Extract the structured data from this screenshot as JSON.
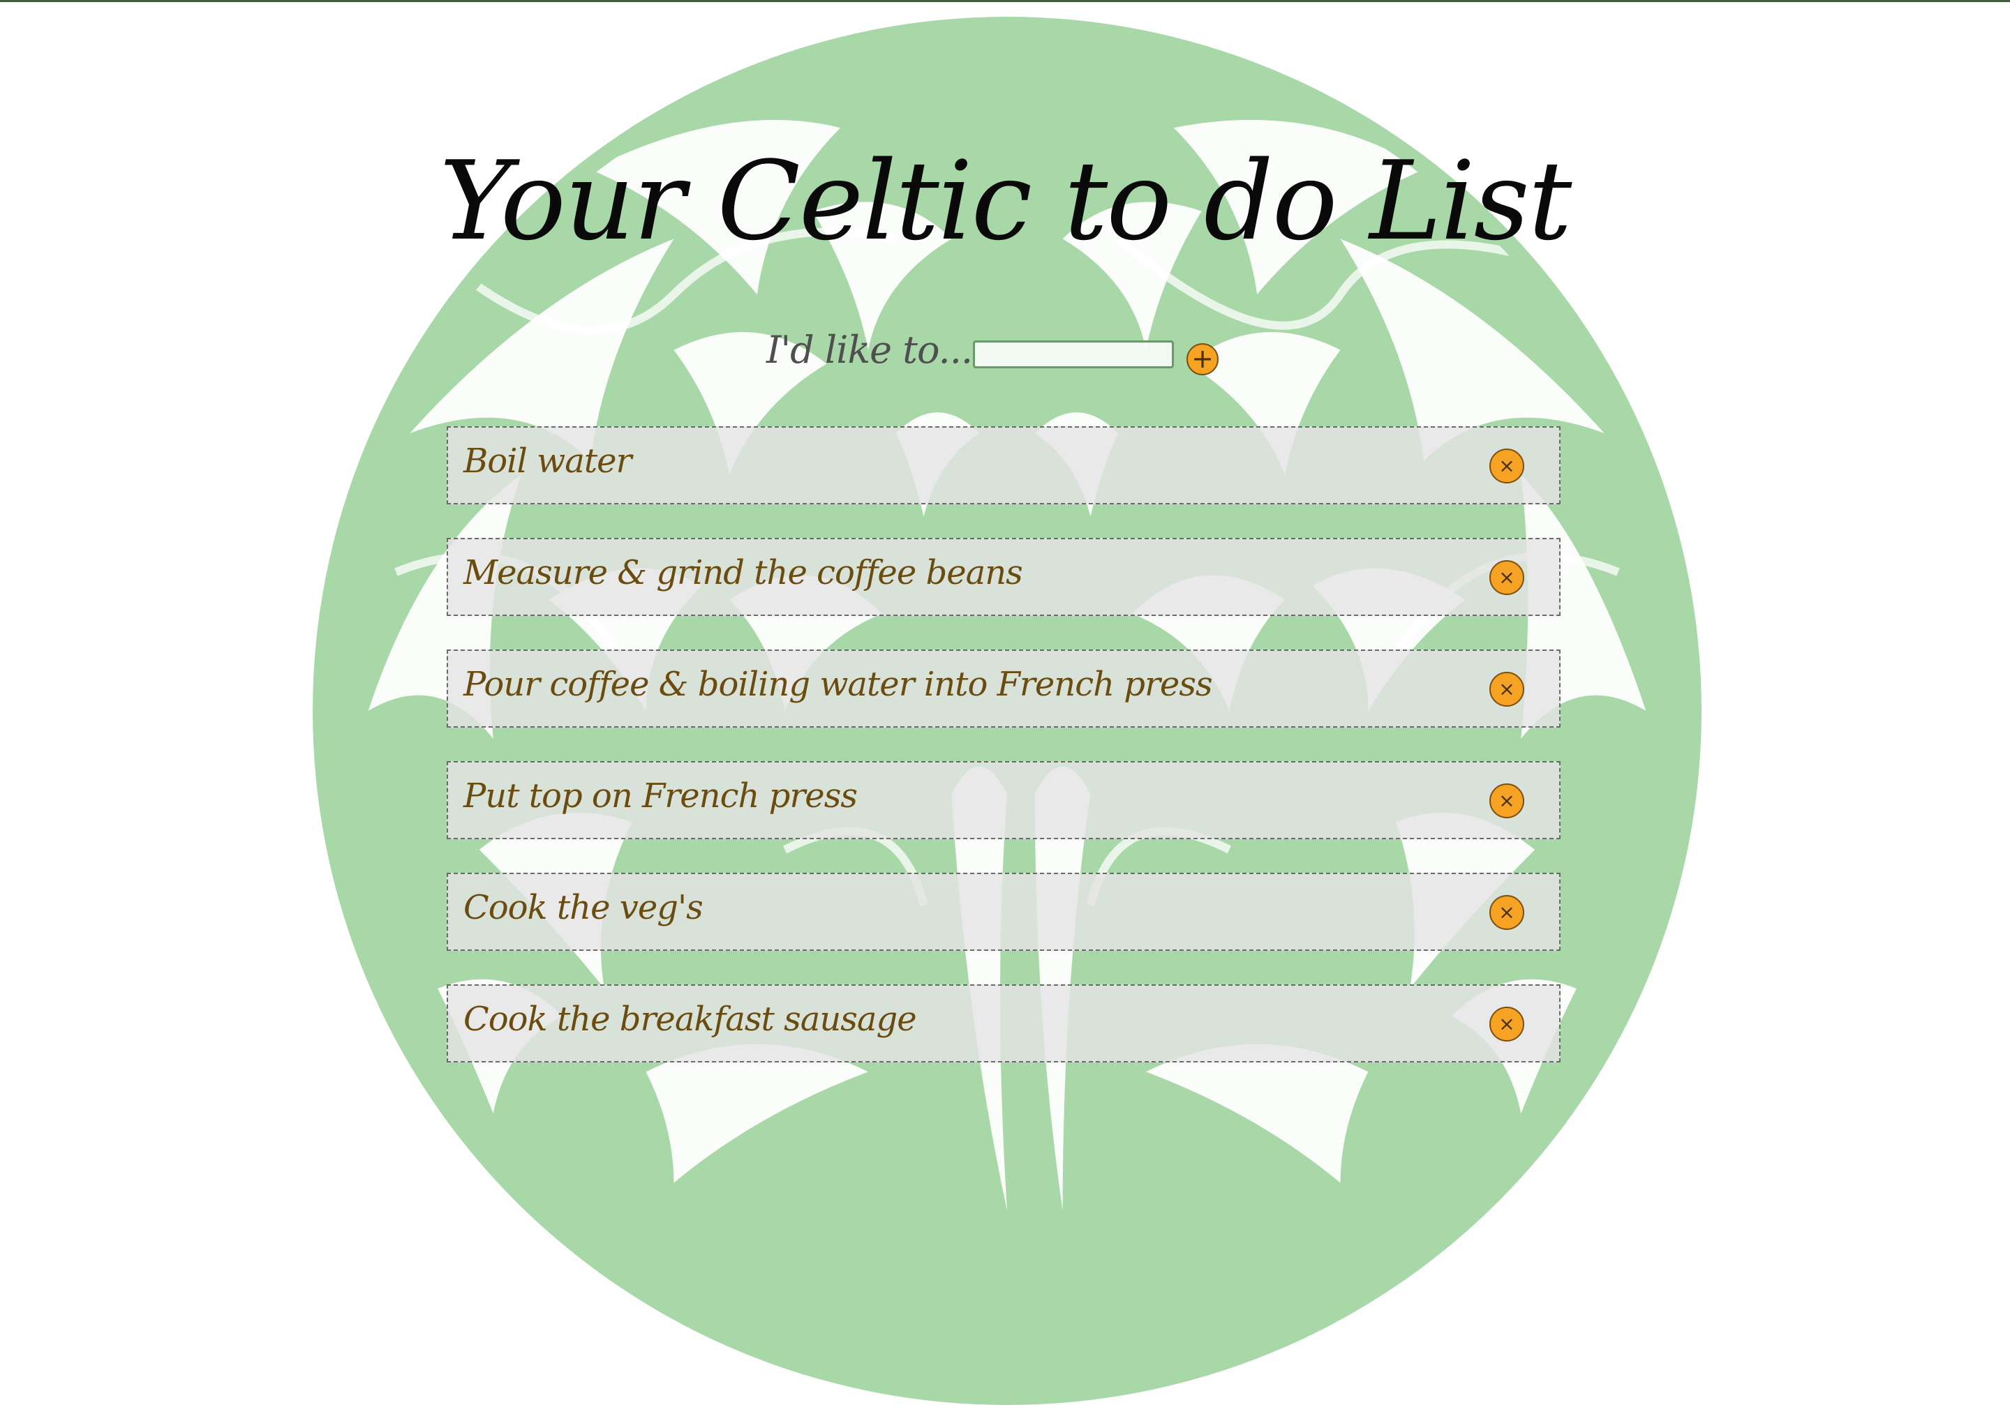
{
  "header": {
    "title": "Your Celtic to do List"
  },
  "add_form": {
    "label": "I'd like to...",
    "input_value": "",
    "add_button_glyph": "+"
  },
  "todos": [
    {
      "text": "Boil water",
      "delete_glyph": "×"
    },
    {
      "text": "Measure & grind the coffee beans",
      "delete_glyph": "×"
    },
    {
      "text": "Pour coffee & boiling water into French press",
      "delete_glyph": "×"
    },
    {
      "text": "Put top on French press",
      "delete_glyph": "×"
    },
    {
      "text": "Cook the veg's",
      "delete_glyph": "×"
    },
    {
      "text": "Cook the breakfast sausage",
      "delete_glyph": "×"
    }
  ],
  "colors": {
    "tree_green": "#a8d8a8",
    "button_orange": "#f6a324",
    "item_text": "#6b4c10",
    "item_background": "#e4e4e4"
  },
  "icons": {
    "background": "celtic-tree-icon",
    "add": "plus-icon",
    "delete": "close-icon"
  }
}
